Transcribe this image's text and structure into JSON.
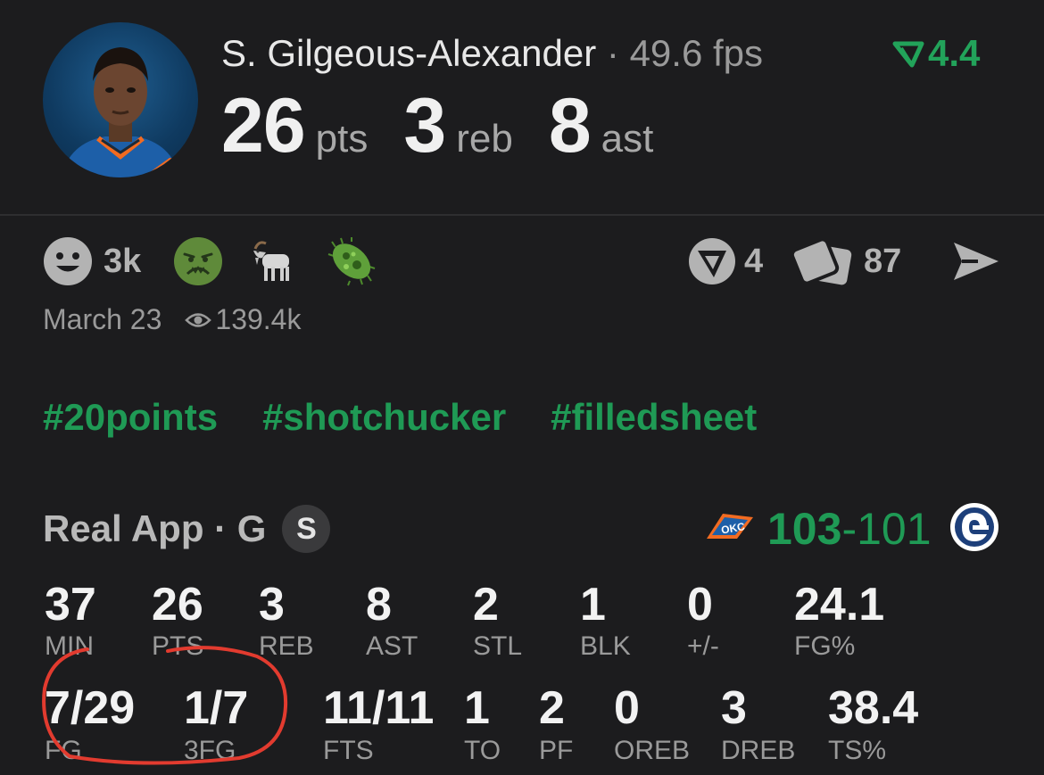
{
  "header": {
    "player_name": "S. Gilgeous-Alexander",
    "separator": " · ",
    "fps": "49.6 fps",
    "rating": "4.4",
    "stats": [
      {
        "value": "26",
        "unit": "pts"
      },
      {
        "value": "3",
        "unit": "reb"
      },
      {
        "value": "8",
        "unit": "ast"
      }
    ]
  },
  "reactions": {
    "smile_count": "3k",
    "shots_count": "4",
    "cards_count": "87"
  },
  "meta": {
    "date": "March 23",
    "views": "139.4k"
  },
  "tags": [
    "#20points",
    "#shotchucker",
    "#filledsheet"
  ],
  "game": {
    "label": "Real App · G",
    "badge": "S",
    "score_home": "103",
    "score_dash": "-",
    "score_away": "101"
  },
  "stats_row1": [
    {
      "value": "37",
      "label": "MIN"
    },
    {
      "value": "26",
      "label": "PTS"
    },
    {
      "value": "3",
      "label": "REB"
    },
    {
      "value": "8",
      "label": "AST"
    },
    {
      "value": "2",
      "label": "STL"
    },
    {
      "value": "1",
      "label": "BLK"
    },
    {
      "value": "0",
      "label": "+/-"
    },
    {
      "value": "24.1",
      "label": "FG%"
    }
  ],
  "stats_row2": [
    {
      "value": "7/29",
      "label": "FG"
    },
    {
      "value": "1/7",
      "label": "3FG"
    },
    {
      "value": "11/11",
      "label": "FTS"
    },
    {
      "value": "1",
      "label": "TO"
    },
    {
      "value": "2",
      "label": "PF"
    },
    {
      "value": "0",
      "label": "OREB"
    },
    {
      "value": "3",
      "label": "DREB"
    },
    {
      "value": "38.4",
      "label": "TS%"
    }
  ],
  "colors": {
    "background": "#1c1c1e",
    "accent_green": "#1f9a55",
    "annotation_red": "#e23b2f",
    "muted_text": "#9a9a9a"
  },
  "icons": [
    "smile-icon",
    "sick-face-icon",
    "goat-icon",
    "microbe-icon",
    "shot-icon",
    "cards-icon",
    "send-icon",
    "eye-icon",
    "okc-logo-icon",
    "opponent-logo-icon"
  ]
}
